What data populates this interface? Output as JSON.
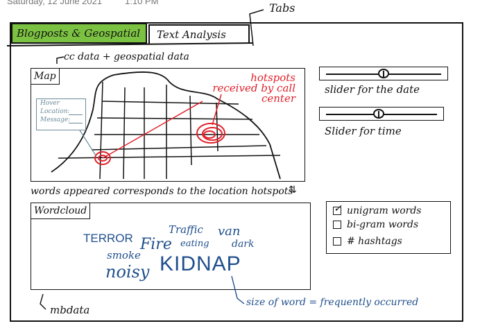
{
  "header": {
    "date": "Saturday, 12 June 2021",
    "time": "1:10 PM"
  },
  "annotations": {
    "tabs": "Tabs",
    "data_note": "cc data + geospatial data",
    "hotspots": "hotspots received by call center",
    "words_note": "words appeared corresponds to the location hotspots",
    "size_note": "size of word = frequently occurred",
    "mb_note": "mbdata"
  },
  "tabs": [
    {
      "label": "Blogposts & Geospatial",
      "active": true
    },
    {
      "label": "Text Analysis",
      "active": false
    }
  ],
  "map": {
    "title": "Map",
    "tooltip": {
      "title": "Hover",
      "fields": [
        "Location:",
        "Message:"
      ]
    }
  },
  "sliders": [
    {
      "label": "slider for the date",
      "value": 0.5
    },
    {
      "label": "Slider for time",
      "value": 0.5
    }
  ],
  "wordcloud": {
    "title": "Wordcloud",
    "words": [
      "TERROR",
      "Traffic",
      "van",
      "Fire",
      "eating",
      "dark",
      "smoke",
      "noisy",
      "KIDNAP"
    ]
  },
  "options": [
    {
      "label": "unigram words",
      "checked": true
    },
    {
      "label": "bi-gram words",
      "checked": false
    },
    {
      "label": "# hashtags",
      "checked": false
    }
  ],
  "colors": {
    "active_tab": "#7cc242",
    "annotation_red": "#e0202a",
    "wordcloud_blue": "#1f4e8c"
  },
  "icons": {
    "arrows": "up-down-arrow-icon"
  }
}
